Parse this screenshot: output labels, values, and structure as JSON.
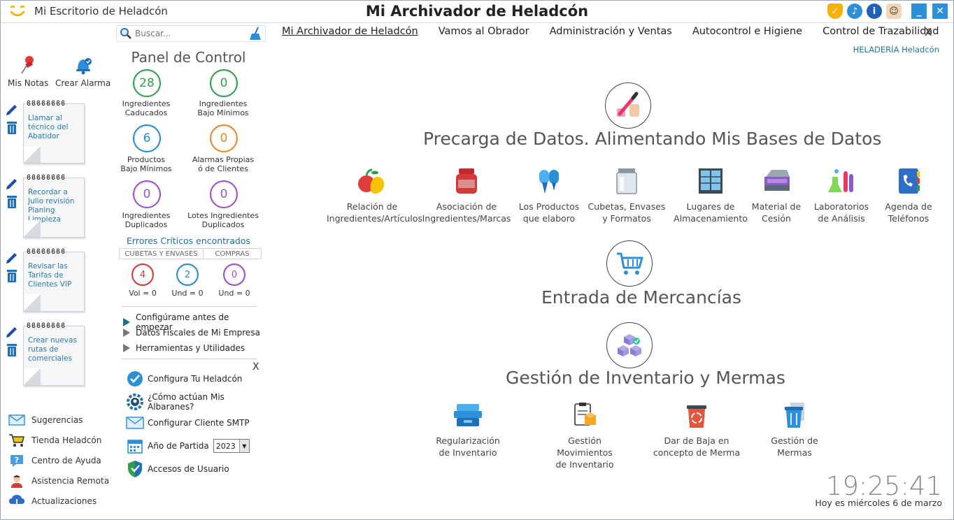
{
  "titlebar": {
    "app_name": "Mi Escritorio de Heladcón",
    "window_title": "Mi Archivador de Heladcón",
    "icons": [
      "shield-icon",
      "bell-icon",
      "info-icon",
      "user-icon"
    ],
    "minimize": "_",
    "close": "✕"
  },
  "quick": {
    "notes": "Mis Notas",
    "alarm": "Crear Alarma"
  },
  "notes": [
    {
      "text": "Llamar al técnico del Abatidor"
    },
    {
      "text": "Recordar a Julio revisión Planing Limpieza"
    },
    {
      "text": "Revisar las Tarifas de Clientes VIP"
    },
    {
      "text": "Crear nuevas rutas de comerciales"
    }
  ],
  "bottom_links": [
    {
      "label": "Sugerencias",
      "icon": "envelope-icon"
    },
    {
      "label": "Tienda Heladcón",
      "icon": "cart-icon"
    },
    {
      "label": "Centro de Ayuda",
      "icon": "help-icon"
    },
    {
      "label": "Asistencia Remota",
      "icon": "support-icon"
    },
    {
      "label": "Actualizaciones",
      "icon": "cloud-download-icon"
    }
  ],
  "search": {
    "placeholder": "Buscar..."
  },
  "panel": {
    "title": "Panel de Control",
    "metrics": [
      {
        "value": "28",
        "label1": "Ingredientes",
        "label2": "Caducados",
        "color": "#2e9e4a"
      },
      {
        "value": "0",
        "label1": "Ingredientes",
        "label2": "Bajo Mínimos",
        "color": "#2e9e4a"
      },
      {
        "value": "6",
        "label1": "Productos",
        "label2": "Bajo Mínimos",
        "color": "#2a8ad0"
      },
      {
        "value": "0",
        "label1": "Alarmas Propias",
        "label2": "ó de Clientes",
        "color": "#e08a2c"
      },
      {
        "value": "0",
        "label1": "Ingredientes",
        "label2": "Duplicados",
        "color": "#9b4fc8"
      },
      {
        "value": "0",
        "label1": "Lotes Ingredientes",
        "label2": "Duplicados",
        "color": "#9b4fc8"
      }
    ],
    "errors_title": "Errores Críticos encontrados",
    "error_tabs": [
      "CUBETAS Y ENVASES",
      "COMPRAS"
    ],
    "errors": [
      {
        "value": "4",
        "label": "Vol = 0",
        "color": "#d23a3a"
      },
      {
        "value": "2",
        "label": "Und = 0",
        "color": "#2a8ad0"
      },
      {
        "value": "0",
        "label": "Und = 0",
        "color": "#9b4fc8"
      }
    ],
    "menu": [
      "Configúrame antes de empezar",
      "Datos Fiscales de Mi Empresa",
      "Herramientas y Utilidades"
    ],
    "config_close": "X",
    "config": [
      {
        "label": "Configura Tu Heladcón",
        "icon": "check-icon"
      },
      {
        "label": "¿Cómo actúan Mis Albaranes?",
        "icon": "gear-icon"
      },
      {
        "label": "Configurar Cliente SMTP",
        "icon": "mail-icon"
      },
      {
        "label": "Año de Partida",
        "icon": "calendar-icon"
      },
      {
        "label": "Accesos de Usuario",
        "icon": "shield-check-icon"
      }
    ],
    "year": "2023"
  },
  "nav": {
    "tabs": [
      "Mi Archivador de Heladcón",
      "Vamos al Obrador",
      "Administración y Ventas",
      "Autocontrol e Higiene",
      "Control de Trazabilidad"
    ],
    "close": "X",
    "company": "HELADERÍA Heladcón"
  },
  "sections": {
    "precarga": {
      "title": "Precarga de Datos. Alimentando Mis Bases de Datos",
      "items": [
        {
          "l1": "Relación de",
          "l2": "Ingredientes/Artículos",
          "icon": "fruit-icon"
        },
        {
          "l1": "Asociación de",
          "l2": "Ingredientes/Marcas",
          "icon": "jar-icon"
        },
        {
          "l1": "Los Productos",
          "l2": "que elaboro",
          "icon": "ice-cream-icon"
        },
        {
          "l1": "Cubetas, Envases",
          "l2": "y Formatos",
          "icon": "container-icon"
        },
        {
          "l1": "Lugares de",
          "l2": "Almacenamiento",
          "icon": "fridge-icon"
        },
        {
          "l1": "Material de",
          "l2": "Cesión",
          "icon": "display-freezer-icon"
        },
        {
          "l1": "Laboratorios",
          "l2": "de Análisis",
          "icon": "lab-flask-icon"
        },
        {
          "l1": "Agenda de",
          "l2": "Teléfonos",
          "icon": "phonebook-icon"
        }
      ]
    },
    "entrada": {
      "title": "Entrada de Mercancías"
    },
    "inventario": {
      "title": "Gestión de Inventario y Mermas",
      "items": [
        {
          "l1": "Regularización",
          "l2": "de Inventario",
          "icon": "boxes-icon"
        },
        {
          "l1": "Gestión Movimientos",
          "l2": "de Inventario",
          "icon": "clipboard-box-icon"
        },
        {
          "l1": "Dar de Baja en",
          "l2": "concepto de Merma",
          "icon": "recycle-bin-icon"
        },
        {
          "l1": "Gestión de",
          "l2": "Mermas",
          "icon": "trash-icon"
        }
      ]
    }
  },
  "clock": {
    "time": "19:25:41",
    "date": "Hoy es miércoles 6 de marzo"
  },
  "colors": {
    "accent": "#2d8fd8",
    "teal": "#1f7a8c",
    "link": "#2a7aa8"
  }
}
